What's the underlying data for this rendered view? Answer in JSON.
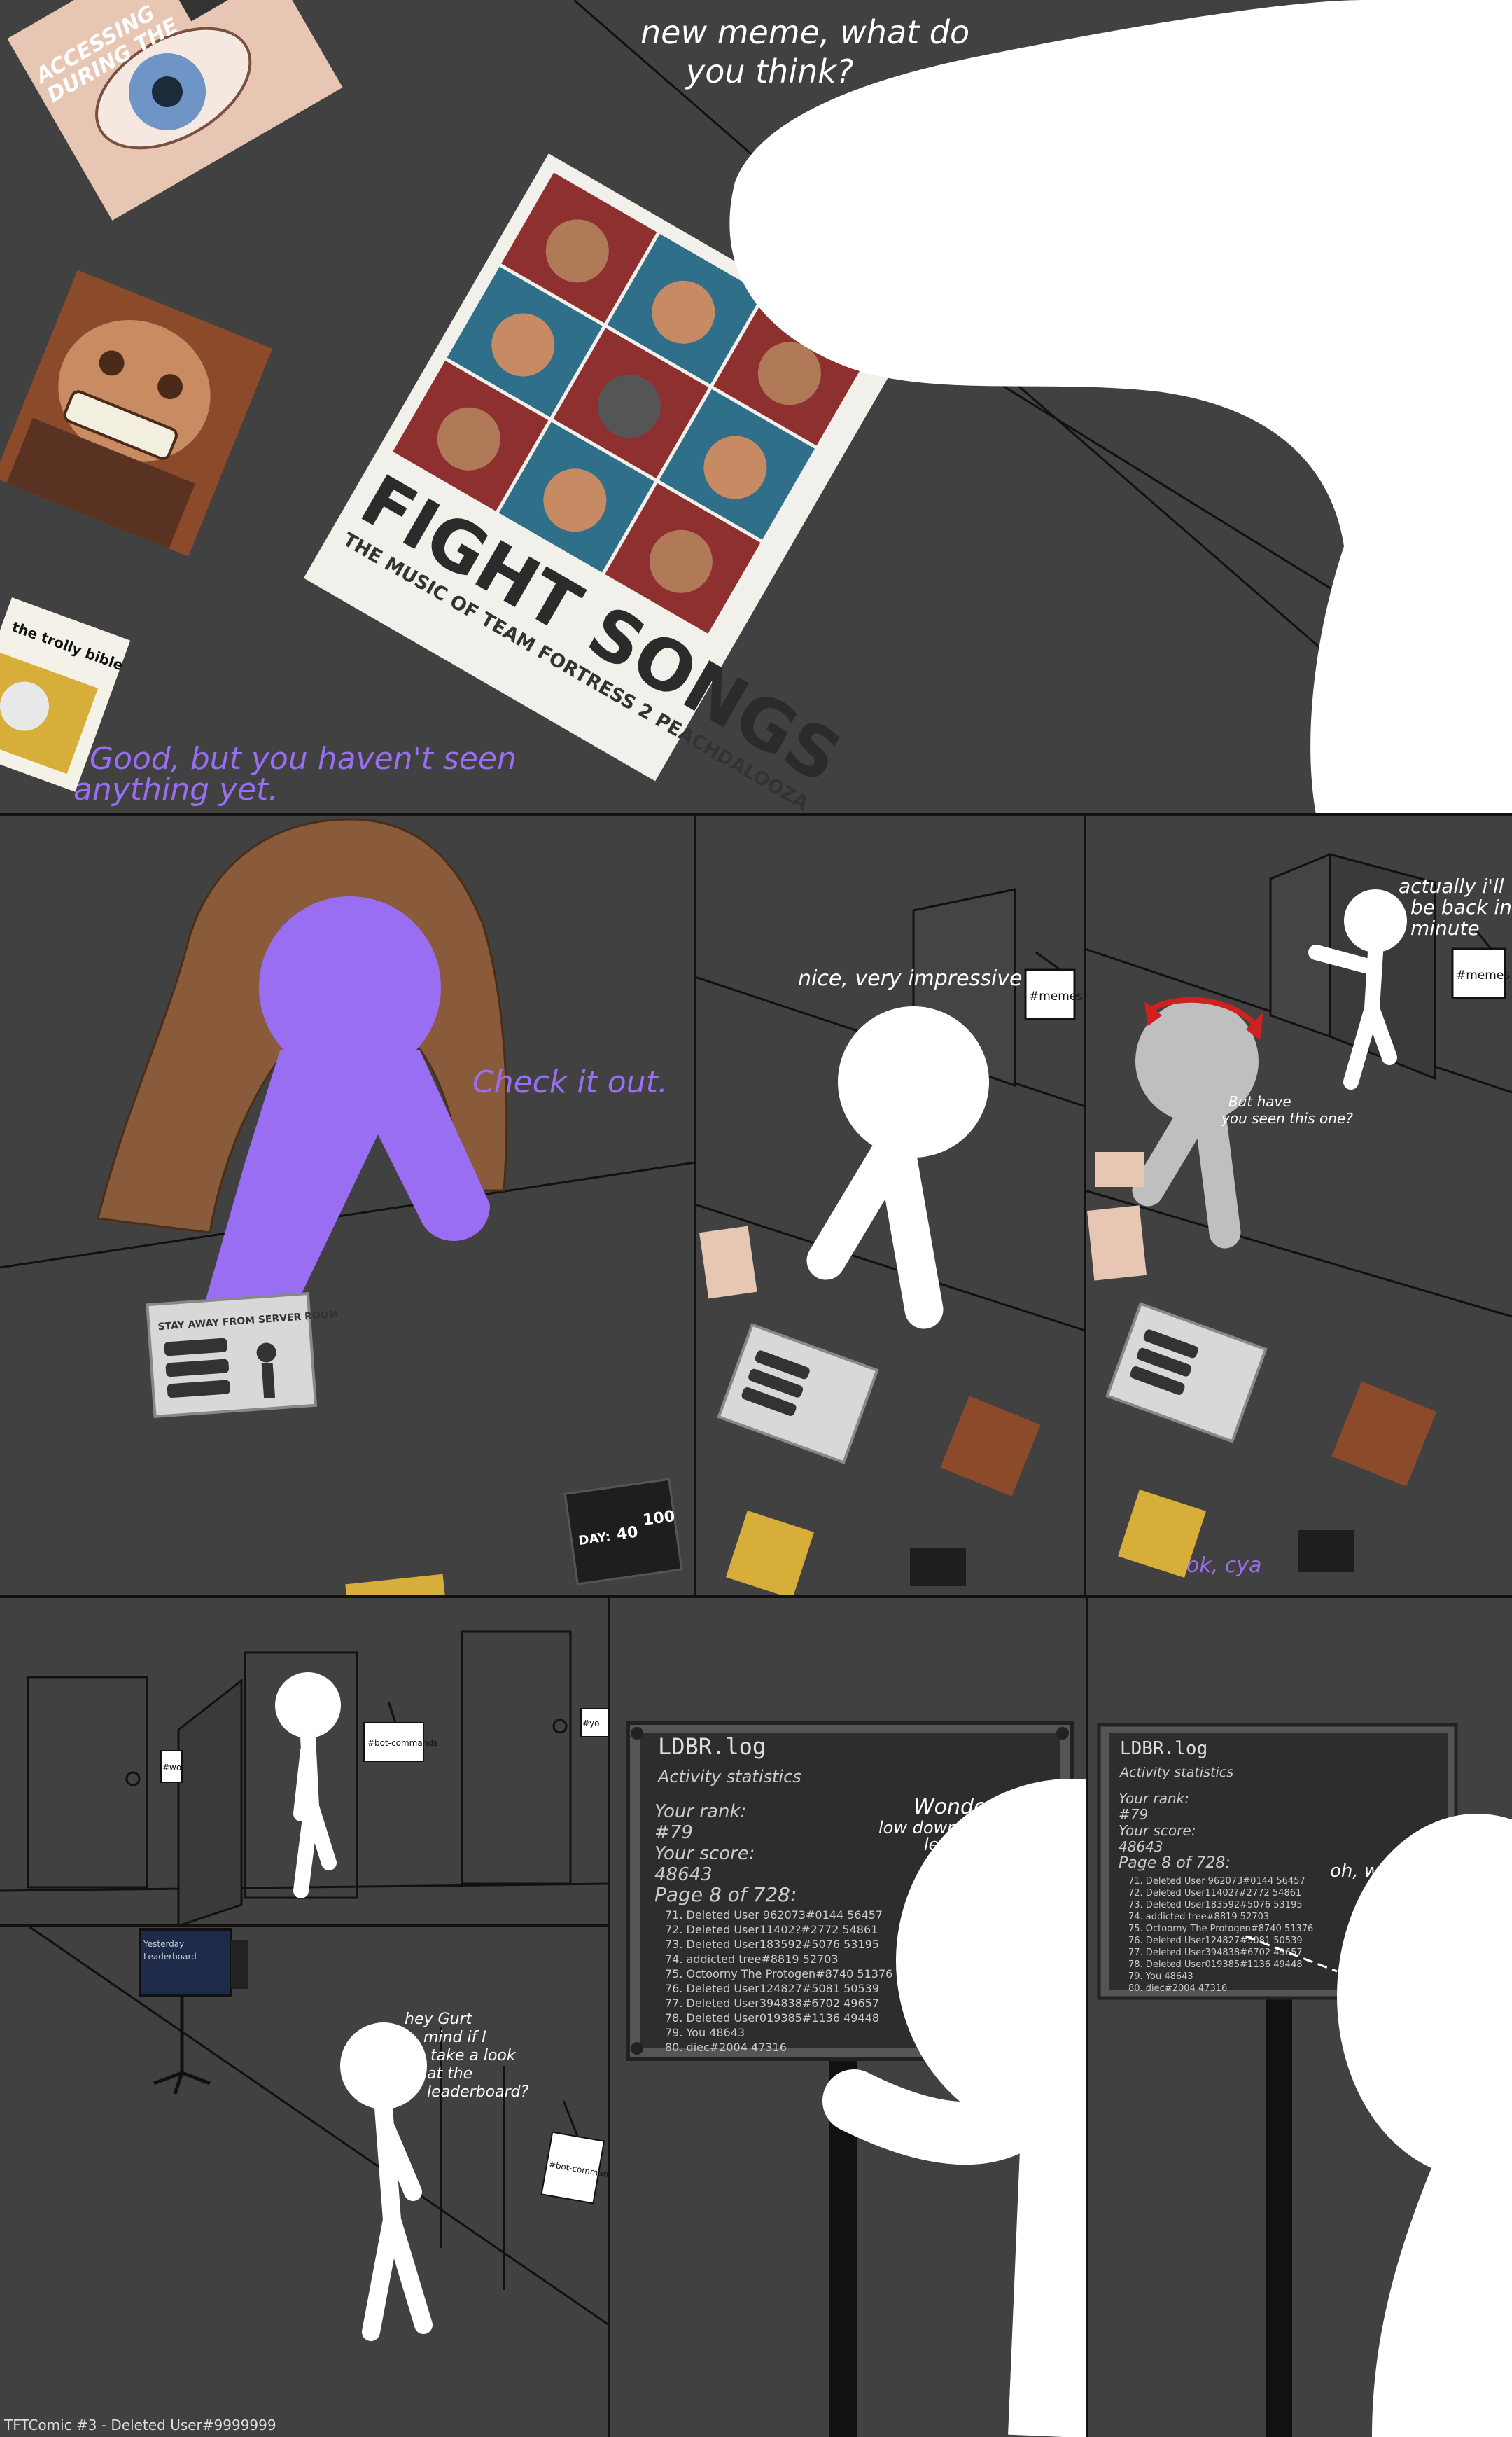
{
  "comic": {
    "credit": "TFTComic #3 - Deleted User#9999999",
    "panel1": {
      "speech_white": [
        "new meme, what do",
        "you think?"
      ],
      "speech_purple": [
        "Good, but you haven't seen",
        "anything yet."
      ],
      "poster_eye_text": [
        "ACCESSING",
        "DURING THE"
      ],
      "poster_album_title": "FIGHT SONGS",
      "poster_album_subtitle": "THE MUSIC OF TEAM FORTRESS 2  PEACHDALOOZA",
      "poster_bible": "the trolly bible"
    },
    "panel2": {
      "speech_purple": "Check it out.",
      "sign_title": "STAY AWAY FROM SERVER ROOM",
      "video_caption": "DAY:",
      "video_n1": "40",
      "video_n2": "100"
    },
    "panel3": {
      "speech": "nice, very impressive",
      "door_sign": "#memes"
    },
    "panel4": {
      "speech_right": [
        "actually i'll",
        "be back in a",
        "minute"
      ],
      "speech_left": [
        "But have",
        "you seen this one?"
      ],
      "speech_purple": "ok, cya",
      "door_sign": "#memes"
    },
    "panel5": {
      "door_signs": [
        "#wo",
        "#bot-commands",
        "#yo"
      ]
    },
    "panel6": {
      "monitor_text": [
        "Yesterday",
        "Leaderboard"
      ],
      "speech": [
        "hey Gurt",
        "mind if I",
        "take a look",
        "at the",
        "leaderboard?"
      ],
      "door_sign": "#bot-commands"
    },
    "leaderboard": {
      "title": "LDBR.log",
      "subtitle": "Activity statistics",
      "rank_label": "Your rank:",
      "rank_value": "#79",
      "score_label": "Your score:",
      "score_value": "48643",
      "page_label": "Page 8 of 728:",
      "rows": [
        "71. Deleted User 962073#0144 56457",
        "72. Deleted User11402?#2772 54861",
        "73. Deleted User183592#5076 53195",
        "74. addicted tree#8819 52703",
        "75. Octoorny The Protogen#8740 51376",
        "76. Deleted User124827#5081 50539",
        "77. Deleted User394838#6702 49657",
        "78. Deleted User019385#1136 49448",
        "79. You 48643",
        "80. diec#2004 47316"
      ]
    },
    "panel7": {
      "speech": [
        "Wonder why I'm so",
        "low down on the",
        "leaderboard?"
      ]
    },
    "panel8": {
      "speech": "oh, wtf"
    }
  }
}
